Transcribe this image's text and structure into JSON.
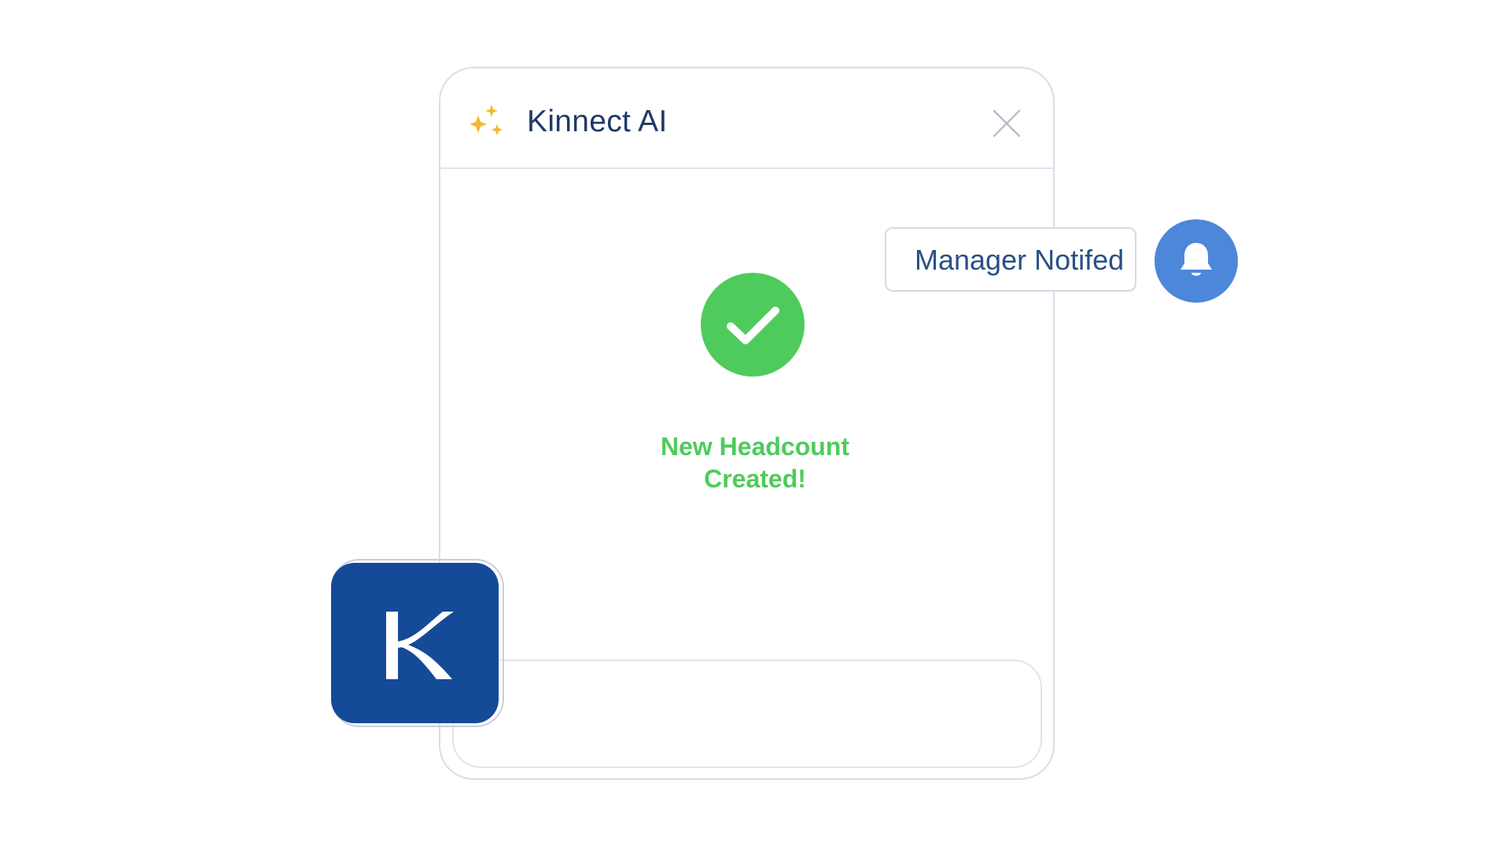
{
  "app": {
    "title": "Kinnect AI",
    "sparkle_icon": "sparkle-icon",
    "close_icon": "close-icon"
  },
  "status": {
    "icon": "check-circle-icon",
    "message_line1": "New Headcount",
    "message_line2": "Created!",
    "color": "#4ecb5c"
  },
  "notification": {
    "label": "Manager Notifed",
    "icon": "bell-icon",
    "accent": "#4d87d9"
  },
  "composer": {
    "value": ""
  },
  "logo": {
    "letter": "K",
    "background": "#154a98"
  }
}
